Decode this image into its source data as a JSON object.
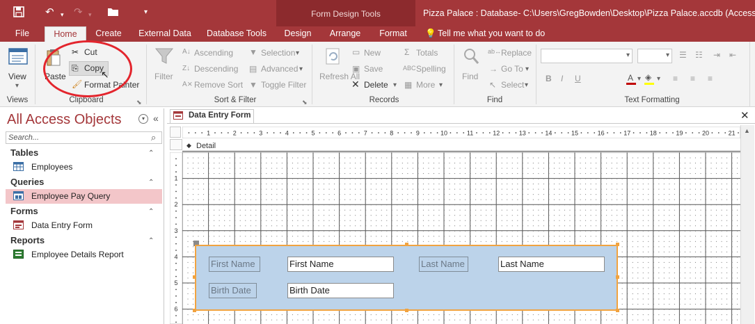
{
  "titlebar": {
    "context_title": "Form Design Tools",
    "window_title": "Pizza Palace : Database- C:\\Users\\GregBowden\\Desktop\\Pizza Palace.accdb (Access 2007 -"
  },
  "tabs": [
    "File",
    "Home",
    "Create",
    "External Data",
    "Database Tools",
    "Design",
    "Arrange",
    "Format"
  ],
  "tell_me": "Tell me what you want to do",
  "ribbon": {
    "view": "View",
    "paste": "Paste",
    "cut": "Cut",
    "copy": "Copy",
    "format_painter": "Format Painter",
    "filter": "Filter",
    "ascending": "Ascending",
    "descending": "Descending",
    "remove_sort": "Remove Sort",
    "selection": "Selection",
    "advanced": "Advanced",
    "toggle_filter": "Toggle Filter",
    "refresh_all": "Refresh All",
    "new": "New",
    "save": "Save",
    "delete": "Delete",
    "totals": "Totals",
    "spelling": "Spelling",
    "more": "More",
    "find": "Find",
    "replace": "Replace",
    "goto": "Go To",
    "select": "Select",
    "groups": {
      "views": "Views",
      "clipboard": "Clipboard",
      "sort_filter": "Sort & Filter",
      "records": "Records",
      "find": "Find",
      "text_formatting": "Text Formatting"
    }
  },
  "nav": {
    "title": "All Access Objects",
    "search_placeholder": "Search...",
    "sections": [
      {
        "name": "Tables",
        "items": [
          "Employees"
        ]
      },
      {
        "name": "Queries",
        "items": [
          "Employee Pay Query"
        ]
      },
      {
        "name": "Forms",
        "items": [
          "Data Entry Form"
        ]
      },
      {
        "name": "Reports",
        "items": [
          "Employee Details Report"
        ]
      }
    ],
    "selected_item": "Employee Pay Query"
  },
  "document": {
    "tab": "Data Entry Form",
    "section": "Detail",
    "ruler_numbers": [
      "1",
      "2",
      "3",
      "4",
      "5",
      "6",
      "7",
      "8",
      "9",
      "10",
      "11",
      "12",
      "13",
      "14",
      "15",
      "16",
      "17",
      "18",
      "19",
      "20",
      "21"
    ],
    "vruler_numbers": [
      "1",
      "2",
      "3",
      "4",
      "5",
      "6"
    ],
    "controls": {
      "first_name_label": "First Name",
      "first_name_text": "First Name",
      "last_name_label": "Last Name",
      "last_name_text": "Last Name",
      "birth_date_label": "Birth Date",
      "birth_date_text": "Birth Date"
    }
  },
  "colors": {
    "accent": "#a4373a",
    "selection_border": "#f1a340",
    "form_fill": "#bcd3ea",
    "annotation_circle": "#e3252d"
  }
}
